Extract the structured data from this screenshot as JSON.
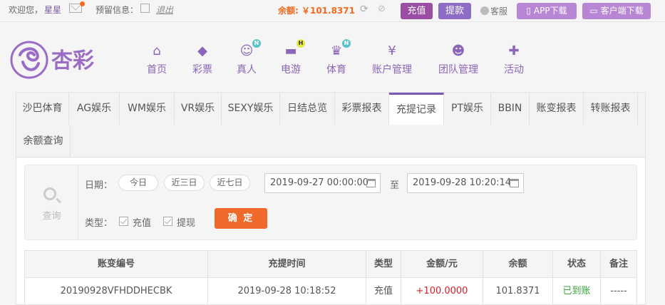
{
  "topbar": {
    "welcome": "欢迎您，",
    "username": "星星",
    "reserve_info": "预留信息：",
    "logout": "退出",
    "balance": "余额: ￥101.8371",
    "deposit": "充值",
    "withdraw": "提款",
    "service": "客服",
    "app_download": "APP下载",
    "client_download": "客户端下载"
  },
  "logo": {
    "text": "杏彩"
  },
  "nav": [
    {
      "label": "首页",
      "icon": "home-icon",
      "badge": ""
    },
    {
      "label": "彩票",
      "icon": "ticket-icon",
      "badge": ""
    },
    {
      "label": "真人",
      "icon": "dealer-icon",
      "badge": "N"
    },
    {
      "label": "电游",
      "icon": "gamepad-icon",
      "badge": "H"
    },
    {
      "label": "体育",
      "icon": "trophy-icon",
      "badge": "N"
    },
    {
      "label": "账户管理",
      "icon": "yen-icon",
      "badge": ""
    },
    {
      "label": "团队管理",
      "icon": "team-icon",
      "badge": ""
    },
    {
      "label": "活动",
      "icon": "gift-icon",
      "badge": ""
    }
  ],
  "tabs": [
    "沙巴体育",
    "AG娱乐",
    "WM娱乐",
    "VR娱乐",
    "SEXY娱乐",
    "日结总览",
    "彩票报表",
    "充提记录",
    "PT娱乐",
    "BBIN",
    "账变报表",
    "转账报表",
    "余额查询"
  ],
  "active_tab": "充提记录",
  "search": {
    "label": "查询",
    "date_label": "日期：",
    "quick": [
      "今日",
      "近三日",
      "近七日"
    ],
    "start": "2019-09-27 00:00:00",
    "to": "至",
    "end": "2019-09-28 10:20:14",
    "type_label": "类型：",
    "types": [
      "充值",
      "提现"
    ],
    "confirm": "确 定"
  },
  "table": {
    "headers": [
      "账变编号",
      "充提时间",
      "类型",
      "金额/元",
      "余额",
      "状态",
      "备注"
    ],
    "rows": [
      [
        "20190928VFHDDHECBK",
        "2019-09-28 10:18:52",
        "充值",
        "+100.0000",
        "101.8371",
        "已到账",
        "-----"
      ]
    ]
  },
  "colors": {
    "accent": "#7a58b4",
    "orange": "#ef6a2a",
    "amount": "#d9202c",
    "status_ok": "#3aa53a"
  }
}
